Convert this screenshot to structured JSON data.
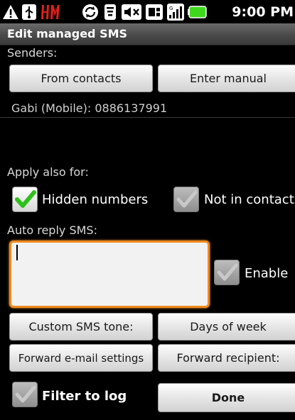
{
  "status": {
    "time": "9:00 PM"
  },
  "title": "Edit managed SMS",
  "senders": {
    "label": "Senders:",
    "from_contacts": "From contacts",
    "enter_manual": "Enter manual",
    "list": [
      "Gabi (Mobile): 0886137991"
    ]
  },
  "apply": {
    "label": "Apply also for:",
    "hidden_numbers": {
      "label": "Hidden numbers",
      "checked": true
    },
    "not_in_contacts": {
      "label": "Not in contacts",
      "checked": false
    }
  },
  "auto_reply": {
    "label": "Auto reply SMS:",
    "value": "",
    "enable": {
      "label": "Enable",
      "checked": false
    }
  },
  "buttons": {
    "custom_tone": "Custom SMS tone:",
    "days_of_week": "Days of week",
    "forward_email": "Forward e-mail settings",
    "forward_recipient": "Forward recipient:",
    "done": "Done"
  },
  "filter_to_log": {
    "label": "Filter to log",
    "checked": false
  },
  "colors": {
    "accent": "#ef8a1c",
    "check_green": "#2fc11b",
    "title_bar": "#4a4a4a"
  }
}
